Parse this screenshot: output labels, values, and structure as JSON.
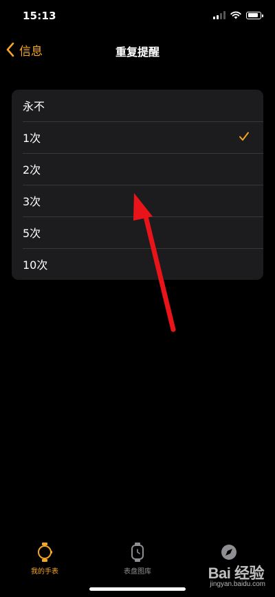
{
  "status_bar": {
    "time": "15:13"
  },
  "nav": {
    "back_label": "信息",
    "title": "重复提醒"
  },
  "options": [
    {
      "label": "永不",
      "selected": false
    },
    {
      "label": "1次",
      "selected": true
    },
    {
      "label": "2次",
      "selected": false
    },
    {
      "label": "3次",
      "selected": false
    },
    {
      "label": "5次",
      "selected": false
    },
    {
      "label": "10次",
      "selected": false
    }
  ],
  "tab_bar": {
    "tabs": [
      {
        "label": "我的手表",
        "icon": "watch-icon",
        "active": true
      },
      {
        "label": "表盘图库",
        "icon": "watch-face-icon",
        "active": false
      },
      {
        "label": "",
        "icon": "compass-icon",
        "active": false
      }
    ]
  },
  "watermark": {
    "brand": "Bai 经验",
    "url": "jingyan.baidu.com"
  },
  "colors": {
    "accent": "#f5a623",
    "background": "#000000",
    "card": "#1c1c1e",
    "annotation": "#e8141a"
  }
}
